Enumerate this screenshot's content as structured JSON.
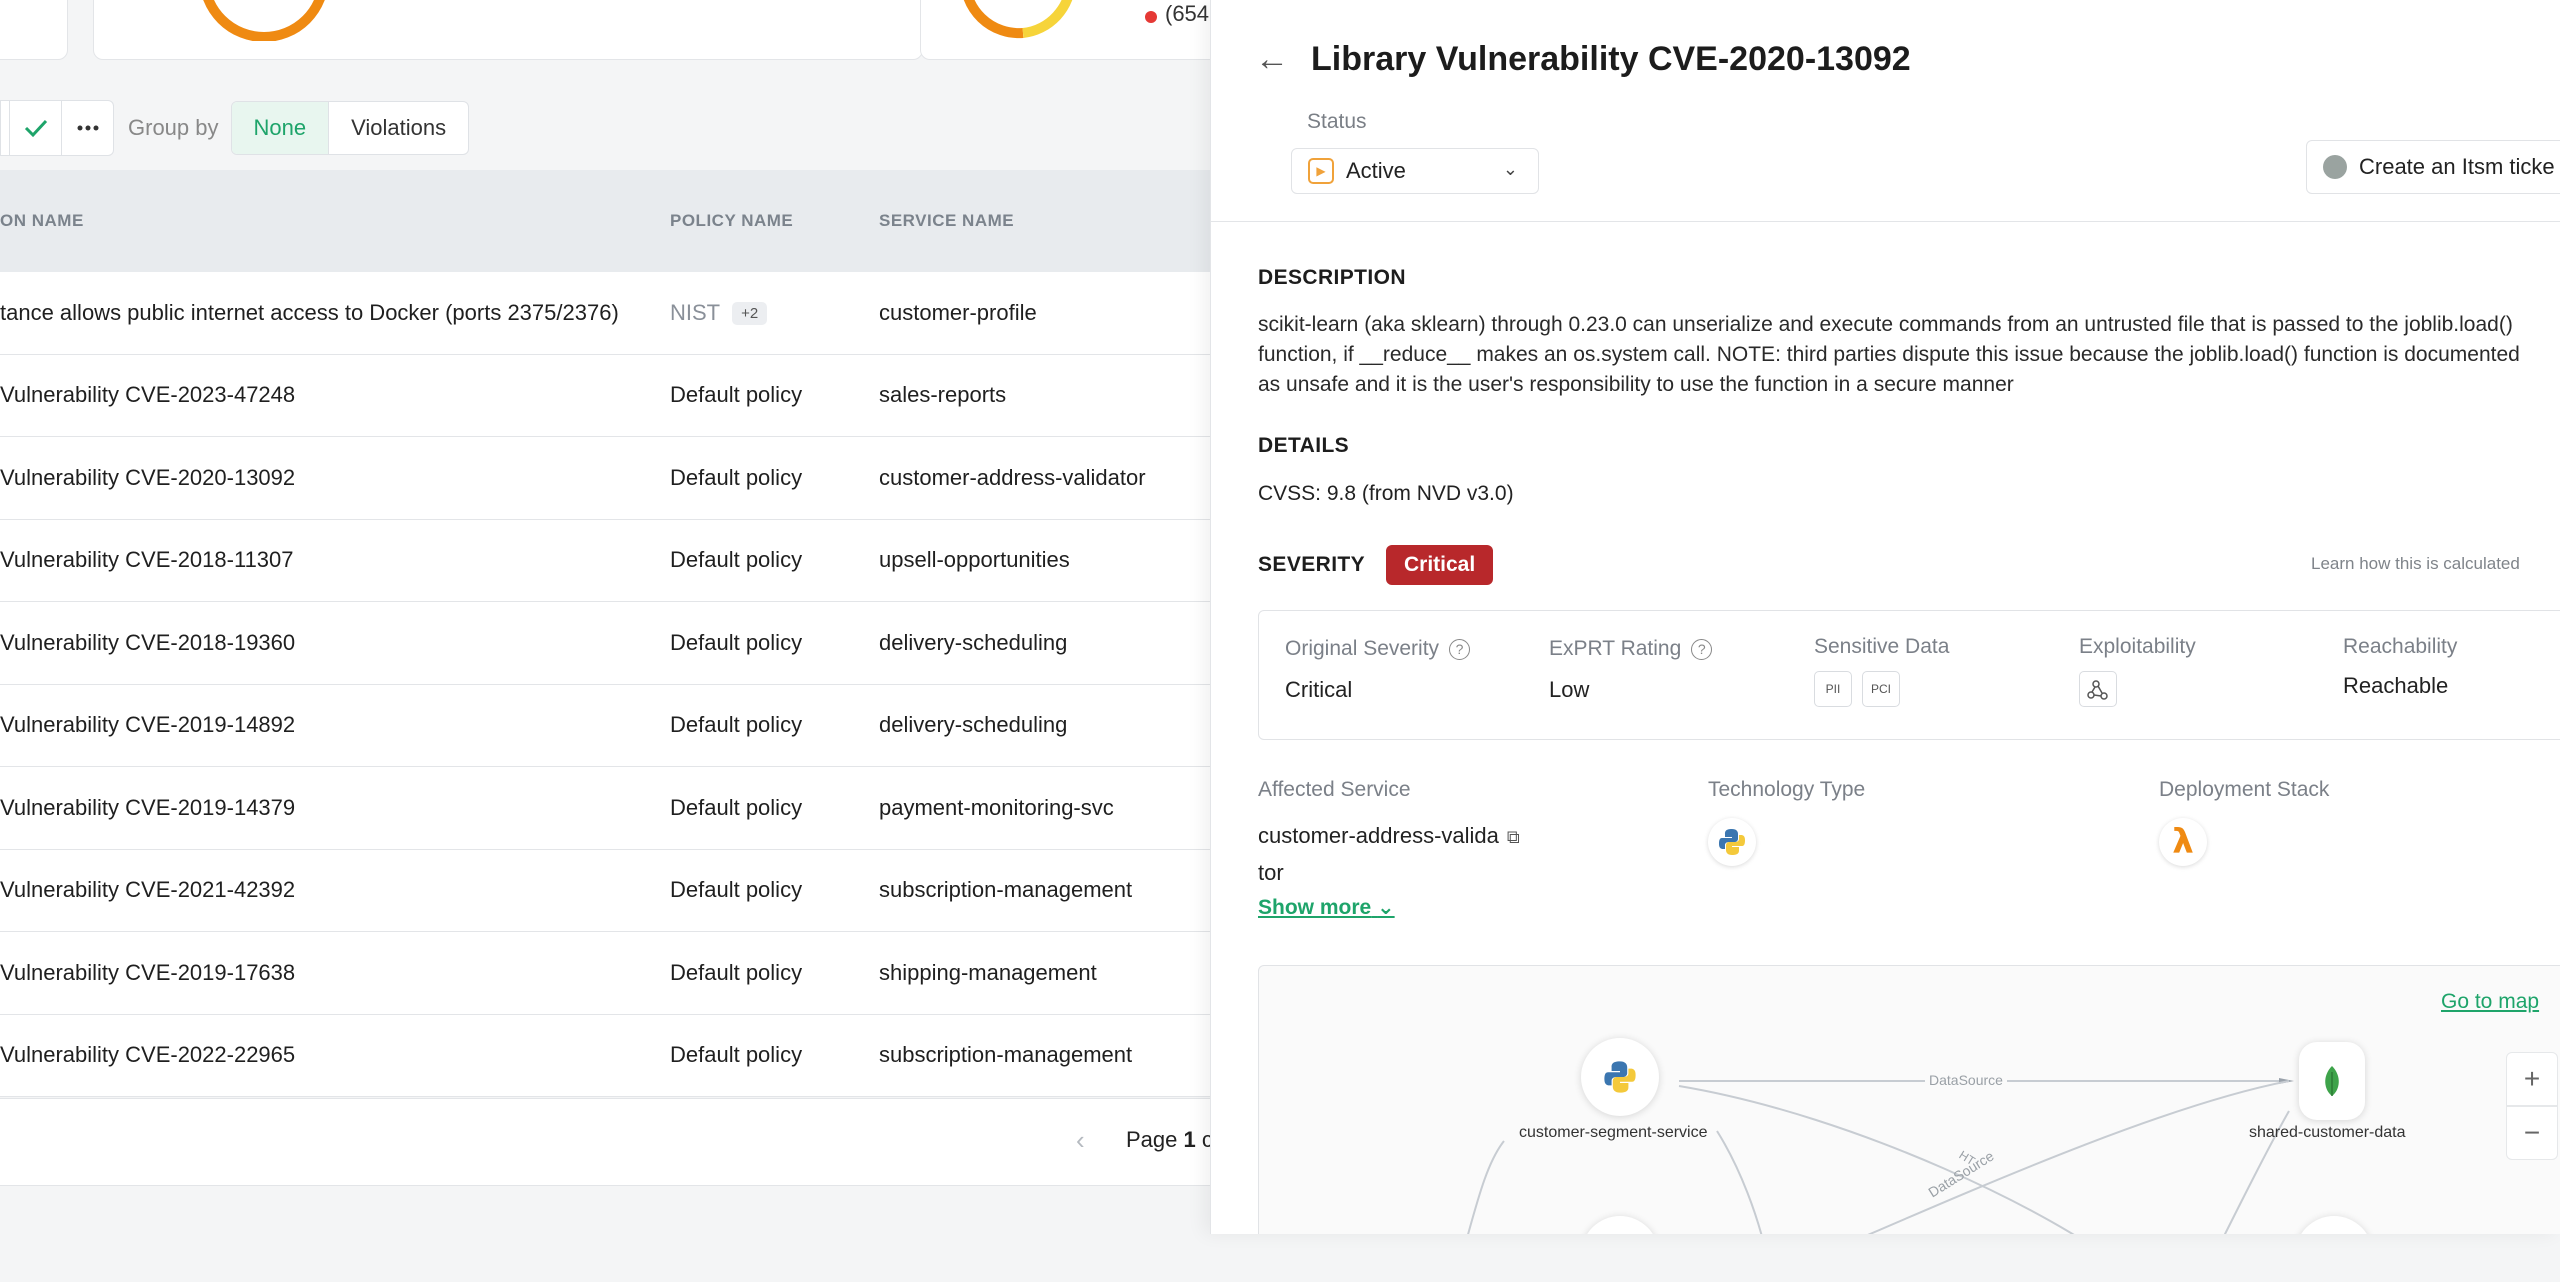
{
  "top_cards": {
    "legend_count": "(654"
  },
  "toolbar": {
    "group_by_label": "Group by",
    "group_none": "None",
    "group_violations": "Violations"
  },
  "table": {
    "headers": [
      "ON NAME",
      "POLICY NAME",
      "SERVICE NAME"
    ],
    "rows": [
      {
        "name": "tance allows public internet access to Docker (ports 2375/2376)",
        "policy": "NIST",
        "extra": "+2",
        "service": "customer-profile"
      },
      {
        "name": "Vulnerability CVE-2023-47248",
        "policy": "Default policy",
        "service": "sales-reports"
      },
      {
        "name": "Vulnerability CVE-2020-13092",
        "policy": "Default policy",
        "service": "customer-address-validator"
      },
      {
        "name": "Vulnerability CVE-2018-11307",
        "policy": "Default policy",
        "service": "upsell-opportunities"
      },
      {
        "name": "Vulnerability CVE-2018-19360",
        "policy": "Default policy",
        "service": "delivery-scheduling"
      },
      {
        "name": "Vulnerability CVE-2019-14892",
        "policy": "Default policy",
        "service": "delivery-scheduling"
      },
      {
        "name": "Vulnerability CVE-2019-14379",
        "policy": "Default policy",
        "service": "payment-monitoring-svc"
      },
      {
        "name": "Vulnerability CVE-2021-42392",
        "policy": "Default policy",
        "service": "subscription-management"
      },
      {
        "name": "Vulnerability CVE-2019-17638",
        "policy": "Default policy",
        "service": "shipping-management"
      },
      {
        "name": "Vulnerability CVE-2022-22965",
        "policy": "Default policy",
        "service": "subscription-management"
      }
    ]
  },
  "pager": {
    "prefix": "Page ",
    "current": "1",
    "suffix": " c"
  },
  "drawer": {
    "title": "Library Vulnerability CVE-2020-13092",
    "status_label": "Status",
    "status_value": "Active",
    "itsm_button": "Create an Itsm ticke",
    "description_heading": "DESCRIPTION",
    "description": "scikit-learn (aka sklearn) through 0.23.0 can unserialize and execute commands from an untrusted file that is passed to the joblib.load() function, if __reduce__ makes an os.system call. NOTE: third parties dispute this issue because the joblib.load() function is documented as unsafe and it is the user's responsibility to use the function in a secure manner",
    "details_heading": "DETAILS",
    "cvss": "CVSS: 9.8 (from NVD v3.0)",
    "severity_heading": "SEVERITY",
    "severity_badge": "Critical",
    "learn_link": "Learn how this is calculated",
    "severity_box": {
      "original_label": "Original Severity",
      "original_value": "Critical",
      "exprt_label": "ExPRT Rating",
      "exprt_value": "Low",
      "sensitive_label": "Sensitive Data",
      "sensitive_tags": [
        "PII",
        "PCI"
      ],
      "exploit_label": "Exploitability",
      "reach_label": "Reachability",
      "reach_value": "Reachable"
    },
    "affected_label": "Affected Service",
    "affected_value_line1": "customer-address-valida",
    "affected_value_line2": "tor",
    "tech_label": "Technology Type",
    "deploy_label": "Deployment Stack",
    "show_more": "Show more",
    "map": {
      "goto": "Go to map",
      "zoom_in": "+",
      "zoom_out": "−",
      "node1": "customer-segment-service",
      "node2": "shared-customer-data",
      "edge1": "DataSource",
      "edge2": "DataSource",
      "edge3": "HT"
    }
  },
  "colors": {
    "accent": "#1ea46a",
    "critical": "#b8282b",
    "ring_orange": "#ef8a12",
    "ring_yellow": "#f6d43a",
    "status_active": "#f0a23a"
  }
}
